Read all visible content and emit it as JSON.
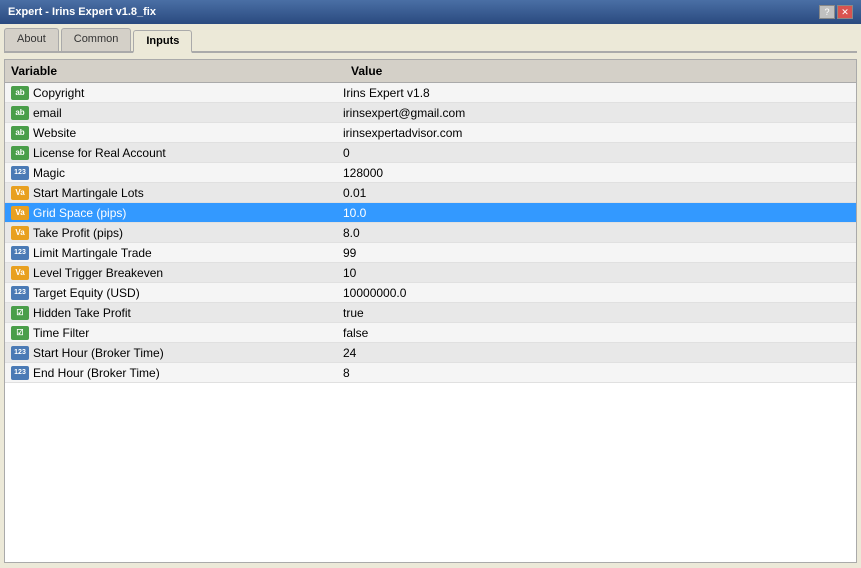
{
  "window": {
    "title": "Expert - Irins Expert v1.8_fix"
  },
  "tabs": [
    {
      "label": "About",
      "active": false
    },
    {
      "label": "Common",
      "active": false
    },
    {
      "label": "Inputs",
      "active": true
    }
  ],
  "table": {
    "col_variable": "Variable",
    "col_value": "Value",
    "rows": [
      {
        "icon": "ab",
        "name": "Copyright",
        "value": "Irins Expert v1.8",
        "selected": false
      },
      {
        "icon": "ab",
        "name": "email",
        "value": "irinsexpert@gmail.com",
        "selected": false
      },
      {
        "icon": "ab",
        "name": "Website",
        "value": "irinsexpertadvisor.com",
        "selected": false
      },
      {
        "icon": "ab",
        "name": "License for Real Account",
        "value": "0",
        "selected": false
      },
      {
        "icon": "123",
        "name": "Magic",
        "value": "128000",
        "selected": false
      },
      {
        "icon": "va",
        "name": "Start Martingale Lots",
        "value": "0.01",
        "selected": false
      },
      {
        "icon": "va",
        "name": "Grid Space (pips)",
        "value": "10.0",
        "selected": true
      },
      {
        "icon": "va",
        "name": "Take Profit (pips)",
        "value": "8.0",
        "selected": false
      },
      {
        "icon": "123",
        "name": "Limit Martingale Trade",
        "value": "99",
        "selected": false
      },
      {
        "icon": "va",
        "name": "Level Trigger Breakeven",
        "value": "10",
        "selected": false
      },
      {
        "icon": "123",
        "name": "Target Equity (USD)",
        "value": "10000000.0",
        "selected": false
      },
      {
        "icon": "bool",
        "name": "Hidden Take Profit",
        "value": "true",
        "selected": false
      },
      {
        "icon": "bool",
        "name": "Time Filter",
        "value": "false",
        "selected": false
      },
      {
        "icon": "123",
        "name": "Start Hour (Broker Time)",
        "value": "24",
        "selected": false
      },
      {
        "icon": "123",
        "name": "End Hour (Broker Time)",
        "value": "8",
        "selected": false
      }
    ]
  },
  "titlebar": {
    "close_label": "✕",
    "min_label": "_",
    "help_label": "?"
  }
}
